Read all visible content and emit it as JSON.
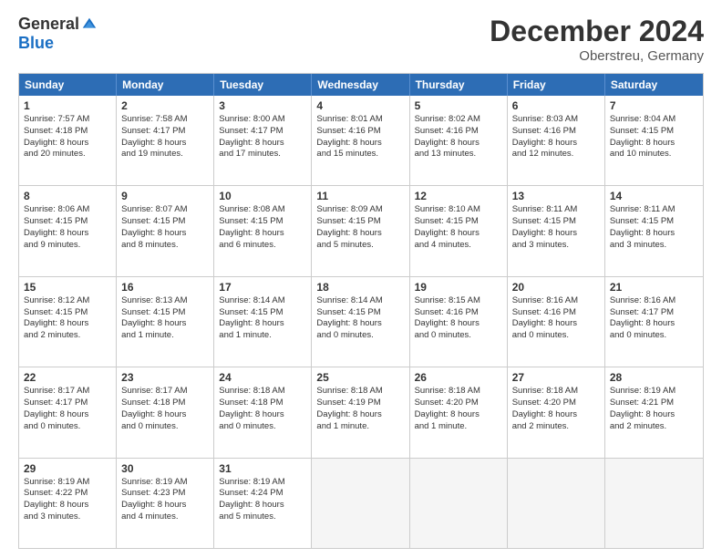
{
  "logo": {
    "general": "General",
    "blue": "Blue"
  },
  "header": {
    "month": "December 2024",
    "location": "Oberstreu, Germany"
  },
  "weekdays": [
    "Sunday",
    "Monday",
    "Tuesday",
    "Wednesday",
    "Thursday",
    "Friday",
    "Saturday"
  ],
  "rows": [
    [
      {
        "day": "1",
        "lines": [
          "Sunrise: 7:57 AM",
          "Sunset: 4:18 PM",
          "Daylight: 8 hours",
          "and 20 minutes."
        ]
      },
      {
        "day": "2",
        "lines": [
          "Sunrise: 7:58 AM",
          "Sunset: 4:17 PM",
          "Daylight: 8 hours",
          "and 19 minutes."
        ]
      },
      {
        "day": "3",
        "lines": [
          "Sunrise: 8:00 AM",
          "Sunset: 4:17 PM",
          "Daylight: 8 hours",
          "and 17 minutes."
        ]
      },
      {
        "day": "4",
        "lines": [
          "Sunrise: 8:01 AM",
          "Sunset: 4:16 PM",
          "Daylight: 8 hours",
          "and 15 minutes."
        ]
      },
      {
        "day": "5",
        "lines": [
          "Sunrise: 8:02 AM",
          "Sunset: 4:16 PM",
          "Daylight: 8 hours",
          "and 13 minutes."
        ]
      },
      {
        "day": "6",
        "lines": [
          "Sunrise: 8:03 AM",
          "Sunset: 4:16 PM",
          "Daylight: 8 hours",
          "and 12 minutes."
        ]
      },
      {
        "day": "7",
        "lines": [
          "Sunrise: 8:04 AM",
          "Sunset: 4:15 PM",
          "Daylight: 8 hours",
          "and 10 minutes."
        ]
      }
    ],
    [
      {
        "day": "8",
        "lines": [
          "Sunrise: 8:06 AM",
          "Sunset: 4:15 PM",
          "Daylight: 8 hours",
          "and 9 minutes."
        ]
      },
      {
        "day": "9",
        "lines": [
          "Sunrise: 8:07 AM",
          "Sunset: 4:15 PM",
          "Daylight: 8 hours",
          "and 8 minutes."
        ]
      },
      {
        "day": "10",
        "lines": [
          "Sunrise: 8:08 AM",
          "Sunset: 4:15 PM",
          "Daylight: 8 hours",
          "and 6 minutes."
        ]
      },
      {
        "day": "11",
        "lines": [
          "Sunrise: 8:09 AM",
          "Sunset: 4:15 PM",
          "Daylight: 8 hours",
          "and 5 minutes."
        ]
      },
      {
        "day": "12",
        "lines": [
          "Sunrise: 8:10 AM",
          "Sunset: 4:15 PM",
          "Daylight: 8 hours",
          "and 4 minutes."
        ]
      },
      {
        "day": "13",
        "lines": [
          "Sunrise: 8:11 AM",
          "Sunset: 4:15 PM",
          "Daylight: 8 hours",
          "and 3 minutes."
        ]
      },
      {
        "day": "14",
        "lines": [
          "Sunrise: 8:11 AM",
          "Sunset: 4:15 PM",
          "Daylight: 8 hours",
          "and 3 minutes."
        ]
      }
    ],
    [
      {
        "day": "15",
        "lines": [
          "Sunrise: 8:12 AM",
          "Sunset: 4:15 PM",
          "Daylight: 8 hours",
          "and 2 minutes."
        ]
      },
      {
        "day": "16",
        "lines": [
          "Sunrise: 8:13 AM",
          "Sunset: 4:15 PM",
          "Daylight: 8 hours",
          "and 1 minute."
        ]
      },
      {
        "day": "17",
        "lines": [
          "Sunrise: 8:14 AM",
          "Sunset: 4:15 PM",
          "Daylight: 8 hours",
          "and 1 minute."
        ]
      },
      {
        "day": "18",
        "lines": [
          "Sunrise: 8:14 AM",
          "Sunset: 4:15 PM",
          "Daylight: 8 hours",
          "and 0 minutes."
        ]
      },
      {
        "day": "19",
        "lines": [
          "Sunrise: 8:15 AM",
          "Sunset: 4:16 PM",
          "Daylight: 8 hours",
          "and 0 minutes."
        ]
      },
      {
        "day": "20",
        "lines": [
          "Sunrise: 8:16 AM",
          "Sunset: 4:16 PM",
          "Daylight: 8 hours",
          "and 0 minutes."
        ]
      },
      {
        "day": "21",
        "lines": [
          "Sunrise: 8:16 AM",
          "Sunset: 4:17 PM",
          "Daylight: 8 hours",
          "and 0 minutes."
        ]
      }
    ],
    [
      {
        "day": "22",
        "lines": [
          "Sunrise: 8:17 AM",
          "Sunset: 4:17 PM",
          "Daylight: 8 hours",
          "and 0 minutes."
        ]
      },
      {
        "day": "23",
        "lines": [
          "Sunrise: 8:17 AM",
          "Sunset: 4:18 PM",
          "Daylight: 8 hours",
          "and 0 minutes."
        ]
      },
      {
        "day": "24",
        "lines": [
          "Sunrise: 8:18 AM",
          "Sunset: 4:18 PM",
          "Daylight: 8 hours",
          "and 0 minutes."
        ]
      },
      {
        "day": "25",
        "lines": [
          "Sunrise: 8:18 AM",
          "Sunset: 4:19 PM",
          "Daylight: 8 hours",
          "and 1 minute."
        ]
      },
      {
        "day": "26",
        "lines": [
          "Sunrise: 8:18 AM",
          "Sunset: 4:20 PM",
          "Daylight: 8 hours",
          "and 1 minute."
        ]
      },
      {
        "day": "27",
        "lines": [
          "Sunrise: 8:18 AM",
          "Sunset: 4:20 PM",
          "Daylight: 8 hours",
          "and 2 minutes."
        ]
      },
      {
        "day": "28",
        "lines": [
          "Sunrise: 8:19 AM",
          "Sunset: 4:21 PM",
          "Daylight: 8 hours",
          "and 2 minutes."
        ]
      }
    ],
    [
      {
        "day": "29",
        "lines": [
          "Sunrise: 8:19 AM",
          "Sunset: 4:22 PM",
          "Daylight: 8 hours",
          "and 3 minutes."
        ]
      },
      {
        "day": "30",
        "lines": [
          "Sunrise: 8:19 AM",
          "Sunset: 4:23 PM",
          "Daylight: 8 hours",
          "and 4 minutes."
        ]
      },
      {
        "day": "31",
        "lines": [
          "Sunrise: 8:19 AM",
          "Sunset: 4:24 PM",
          "Daylight: 8 hours",
          "and 5 minutes."
        ]
      },
      null,
      null,
      null,
      null
    ]
  ]
}
